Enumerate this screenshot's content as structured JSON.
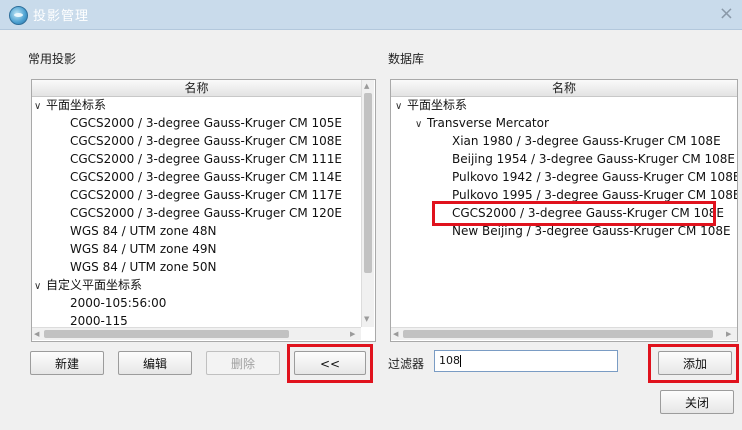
{
  "window": {
    "title": "投影管理",
    "close_symbol": "×"
  },
  "left_panel": {
    "label": "常用投影",
    "column_header": "名称",
    "groups": [
      {
        "name": "平面坐标系",
        "caret": "∨",
        "items": [
          "CGCS2000 / 3-degree Gauss-Kruger CM 105E",
          "CGCS2000 / 3-degree Gauss-Kruger CM 108E",
          "CGCS2000 / 3-degree Gauss-Kruger CM 111E",
          "CGCS2000 / 3-degree Gauss-Kruger CM 114E",
          "CGCS2000 / 3-degree Gauss-Kruger CM 117E",
          "CGCS2000 / 3-degree Gauss-Kruger CM 120E",
          "WGS 84 / UTM zone 48N",
          "WGS 84 / UTM zone 49N",
          "WGS 84 / UTM zone 50N"
        ]
      },
      {
        "name": "自定义平面坐标系",
        "caret": "∨",
        "items": [
          "2000-105:56:00",
          "2000-115"
        ]
      }
    ],
    "buttons": {
      "new": "新建",
      "edit": "编辑",
      "delete": "删除",
      "move_left": "<<"
    }
  },
  "right_panel": {
    "label": "数据库",
    "column_header": "名称",
    "root": {
      "name": "平面坐标系",
      "caret": "∨"
    },
    "child": {
      "name": "Transverse Mercator",
      "caret": "∨"
    },
    "items": [
      "Xian 1980 / 3-degree Gauss-Kruger CM 108E",
      "Beijing 1954 / 3-degree Gauss-Kruger CM 108E",
      "Pulkovo 1942 / 3-degree Gauss-Kruger CM 108E",
      "Pulkovo 1995 / 3-degree Gauss-Kruger CM 108E",
      "CGCS2000 / 3-degree Gauss-Kruger CM 108E",
      "New Beijing / 3-degree Gauss-Kruger CM 108E"
    ],
    "highlighted_item": "CGCS2000 / 3-degree Gauss-Kruger CM 108E",
    "filter": {
      "label": "过滤器",
      "value": "108"
    },
    "buttons": {
      "add": "添加",
      "close": "关闭"
    }
  },
  "scroll_arrows": {
    "up": "▲",
    "down": "▼",
    "left": "◀",
    "right": "▶"
  },
  "colors": {
    "title_bar": "#c9dbeb",
    "highlight_border": "#e0121d"
  }
}
